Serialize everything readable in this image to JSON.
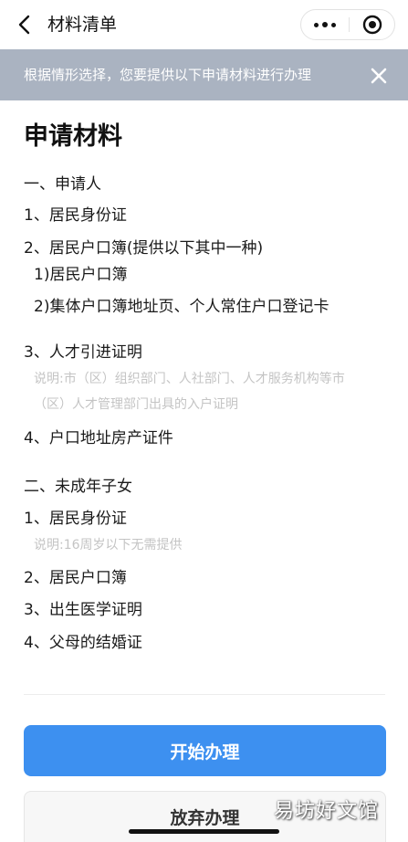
{
  "header": {
    "title": "材料清单",
    "back_icon": "chevron-left-icon",
    "more_icon": "more-dots-icon",
    "close_icon": "target-circle-icon"
  },
  "notice": {
    "text": "根据情形选择，您要提供以下申请材料进行办理",
    "close_icon": "close-icon"
  },
  "main": {
    "title": "申请材料",
    "sections": [
      {
        "heading": "一、申请人",
        "items": [
          {
            "text": "1、居民身份证"
          },
          {
            "text": "2、居民户口簿(提供以下其中一种)"
          },
          {
            "text": "1)居民户口簿"
          },
          {
            "text": "2)集体户口簿地址页、个人常住户口登记卡"
          },
          {
            "text": "3、人才引进证明"
          },
          {
            "note_line1": "说明:市（区）组织部门、人社部门、人才服务机构等市",
            "note_line2": "（区）人才管理部门出具的入户证明"
          },
          {
            "text": "4、户口地址房产证件"
          }
        ]
      },
      {
        "heading": "二、未成年子女",
        "items": [
          {
            "text": "1、居民身份证"
          },
          {
            "note": "说明:16周岁以下无需提供"
          },
          {
            "text": "2、居民户口簿"
          },
          {
            "text": "3、出生医学证明"
          },
          {
            "text": "4、父母的结婚证"
          }
        ]
      }
    ]
  },
  "actions": {
    "start_label": "开始办理",
    "abandon_label": "放弃办理"
  },
  "watermark": "易坊好文馆",
  "colors": {
    "primary": "#3d90f0",
    "notice_bg": "#aab3c1",
    "note_text": "#c4c4c4"
  }
}
